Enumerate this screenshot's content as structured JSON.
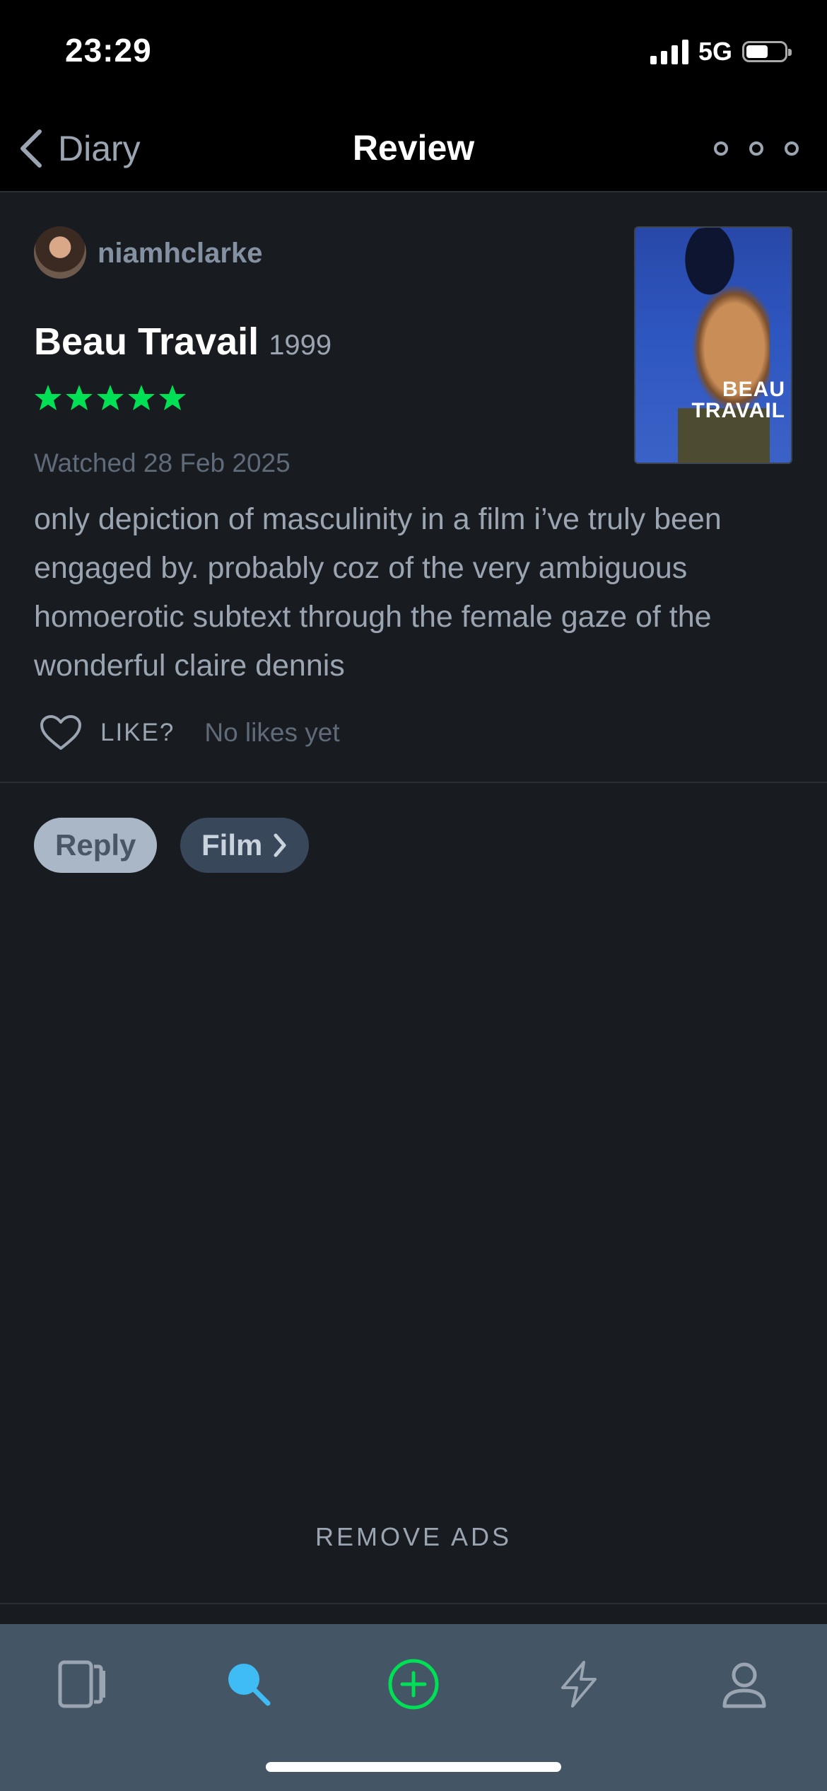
{
  "status_bar": {
    "time": "23:29",
    "network": "5G"
  },
  "nav": {
    "back_label": "Diary",
    "title": "Review"
  },
  "review": {
    "username": "niamhclarke",
    "film_title": "Beau Travail",
    "film_year": "1999",
    "rating_stars": 5,
    "watched_date": "Watched 28 Feb 2025",
    "text": "only depiction of masculinity in a film i’ve truly been engaged by. probably coz of the very ambiguous homoerotic subtext through the female gaze of the wonderful claire dennis",
    "poster_title": "BEAU TRAVAIL",
    "like_label": "LIKE?",
    "likes_count": "No likes yet"
  },
  "actions": {
    "reply_label": "Reply",
    "film_label": "Film"
  },
  "ads": {
    "remove_label": "REMOVE ADS"
  },
  "tab_bar": {
    "tabs": [
      "diary-icon",
      "search-icon",
      "add-icon",
      "activity-icon",
      "profile-icon"
    ],
    "active_tab": "search-icon"
  },
  "colors": {
    "star": "#00e054",
    "search_active": "#40bcf4",
    "add_green": "#00e054",
    "tab_bar_bg": "#445566"
  }
}
